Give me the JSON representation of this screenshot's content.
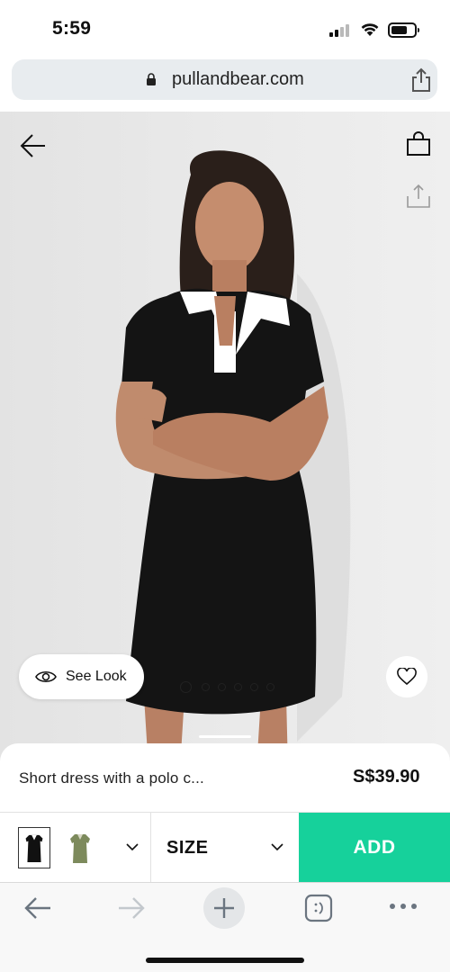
{
  "status_bar": {
    "time": "5:59"
  },
  "browser": {
    "url": "pullandbear.com"
  },
  "product": {
    "see_look_label": "See Look",
    "carousel": {
      "total_images": 6,
      "current_index": 1
    },
    "name": "Short dress with a polo c...",
    "price": "S$39.90",
    "colors": [
      "black",
      "khaki green"
    ],
    "size_label": "SIZE",
    "add_label": "ADD"
  },
  "colors": {
    "accent": "#16d19b",
    "dress": "#141414",
    "collar": "#ffffff"
  },
  "icons": {
    "back": "arrow-left-icon",
    "bag": "shopping-bag-icon",
    "share": "share-icon",
    "eye": "eye-icon",
    "heart": "heart-icon",
    "lock": "lock-icon"
  }
}
